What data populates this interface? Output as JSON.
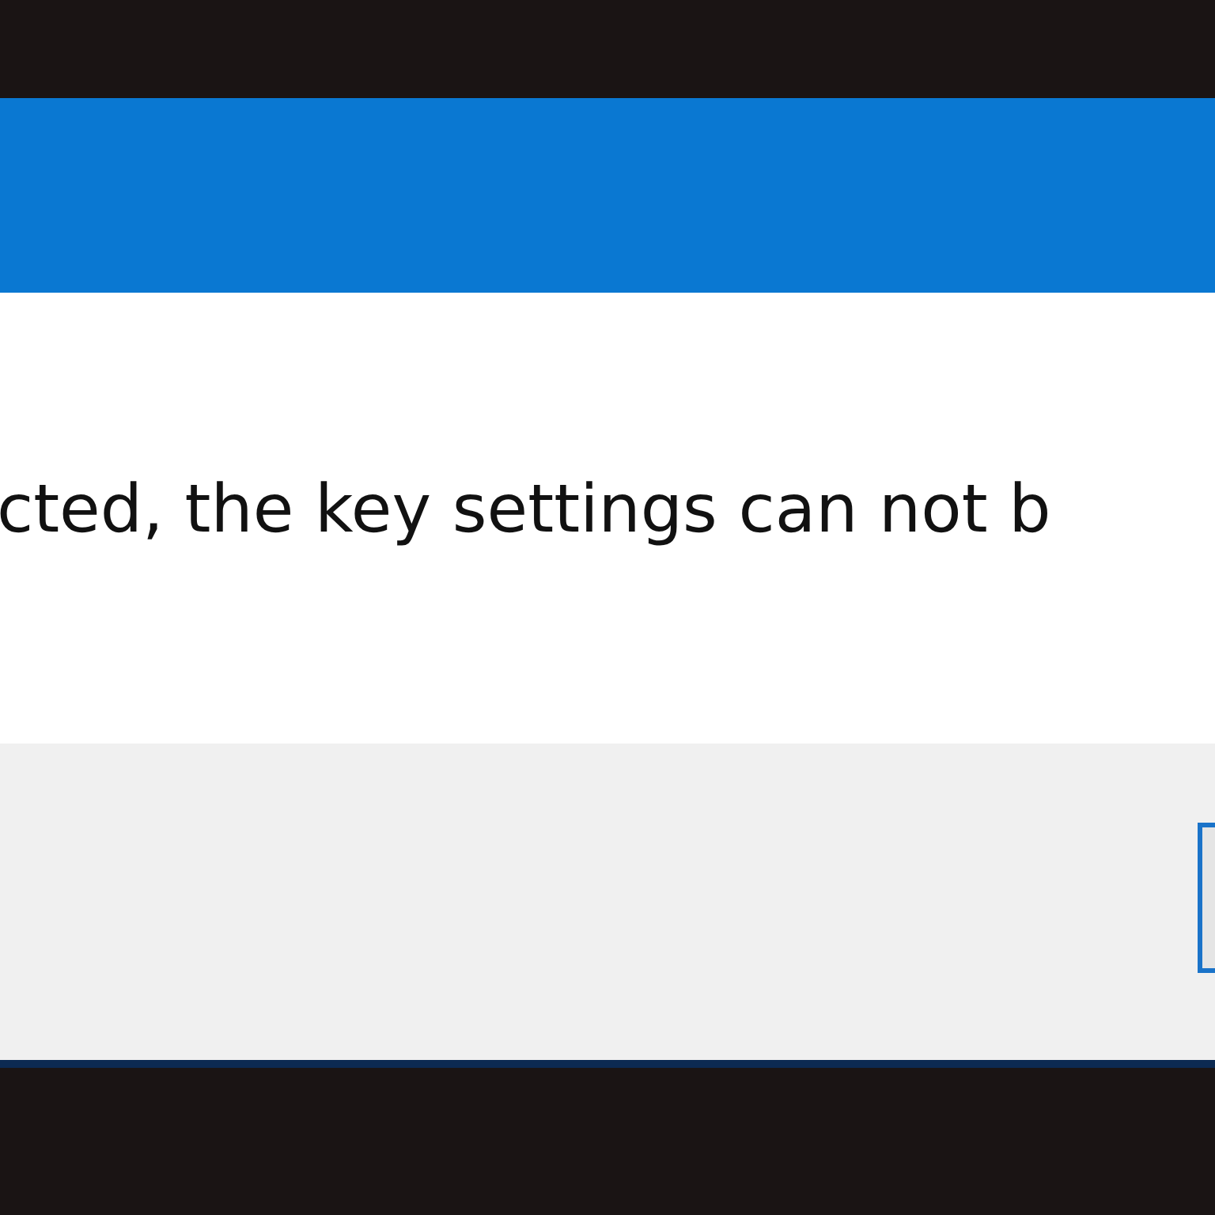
{
  "dialog": {
    "message": "cted, the key settings can not b"
  }
}
